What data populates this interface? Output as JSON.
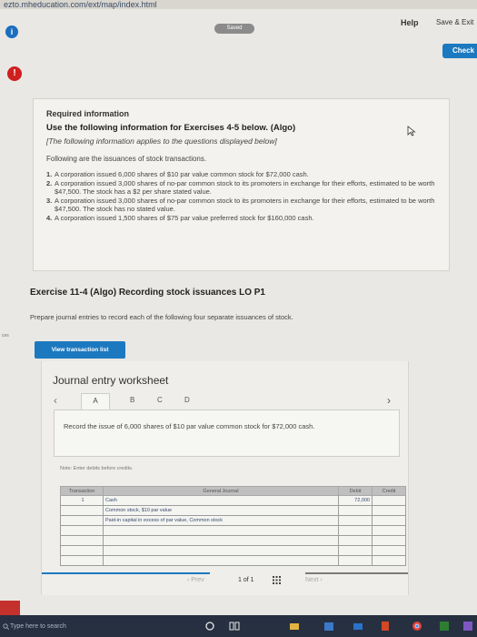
{
  "browser": {
    "url": "ezto.mheducation.com/ext/map/index.html"
  },
  "header": {
    "saved": "Saved",
    "help": "Help",
    "save_exit": "Save & Exit",
    "check": "Check"
  },
  "required": {
    "title": "Required information",
    "subtitle": "Use the following information for Exercises 4-5 below. (Algo)",
    "italic": "[The following information applies to the questions displayed below]",
    "intro": "Following are the issuances of stock transactions.",
    "items": [
      {
        "num": "1.",
        "text": "A corporation issued 6,000 shares of $10 par value common stock for $72,000 cash."
      },
      {
        "num": "2.",
        "text": "A corporation issued 3,000 shares of no-par common stock to its promoters in exchange for their efforts, estimated to be worth $47,500. The stock has a $2 per share stated value."
      },
      {
        "num": "3.",
        "text": "A corporation issued 3,000 shares of no-par common stock to its promoters in exchange for their efforts, estimated to be worth $47,500. The stock has no stated value."
      },
      {
        "num": "4.",
        "text": "A corporation issued 1,500 shares of $75 par value preferred stock for $160,000 cash."
      }
    ]
  },
  "exercise": {
    "title": "Exercise 11-4 (Algo) Recording stock issuances LO P1",
    "prompt": "Prepare journal entries to record each of the following four separate issuances of stock.",
    "view_button": "View transaction list"
  },
  "side_cut": "ces",
  "worksheet": {
    "title": "Journal entry worksheet",
    "tabs": [
      "A",
      "B",
      "C",
      "D"
    ],
    "record": "Record the issue of 6,000 shares of $10 par value common stock for $72,000 cash.",
    "note": "Note: Enter debits before credits.",
    "headers": {
      "transaction": "Transaction",
      "journal": "General Journal",
      "debit": "Debit",
      "credit": "Credit"
    },
    "rows": [
      {
        "txn": "1",
        "account": "Cash",
        "debit": "72,000",
        "credit": ""
      },
      {
        "txn": "",
        "account": "Common stock, $10 par value",
        "debit": "",
        "credit": ""
      },
      {
        "txn": "",
        "account": "Paid-in capital in excess of par value, Common stock",
        "debit": "",
        "credit": ""
      },
      {
        "txn": "",
        "account": "",
        "debit": "",
        "credit": ""
      },
      {
        "txn": "",
        "account": "",
        "debit": "",
        "credit": ""
      },
      {
        "txn": "",
        "account": "",
        "debit": "",
        "credit": ""
      },
      {
        "txn": "",
        "account": "",
        "debit": "",
        "credit": ""
      }
    ]
  },
  "pager": {
    "prev": "Prev",
    "page": "1 of 1",
    "next": "Next"
  },
  "taskbar": {
    "search": "Type here to search"
  },
  "colors": {
    "accent": "#1c79c0",
    "alert": "#d01f1f"
  }
}
